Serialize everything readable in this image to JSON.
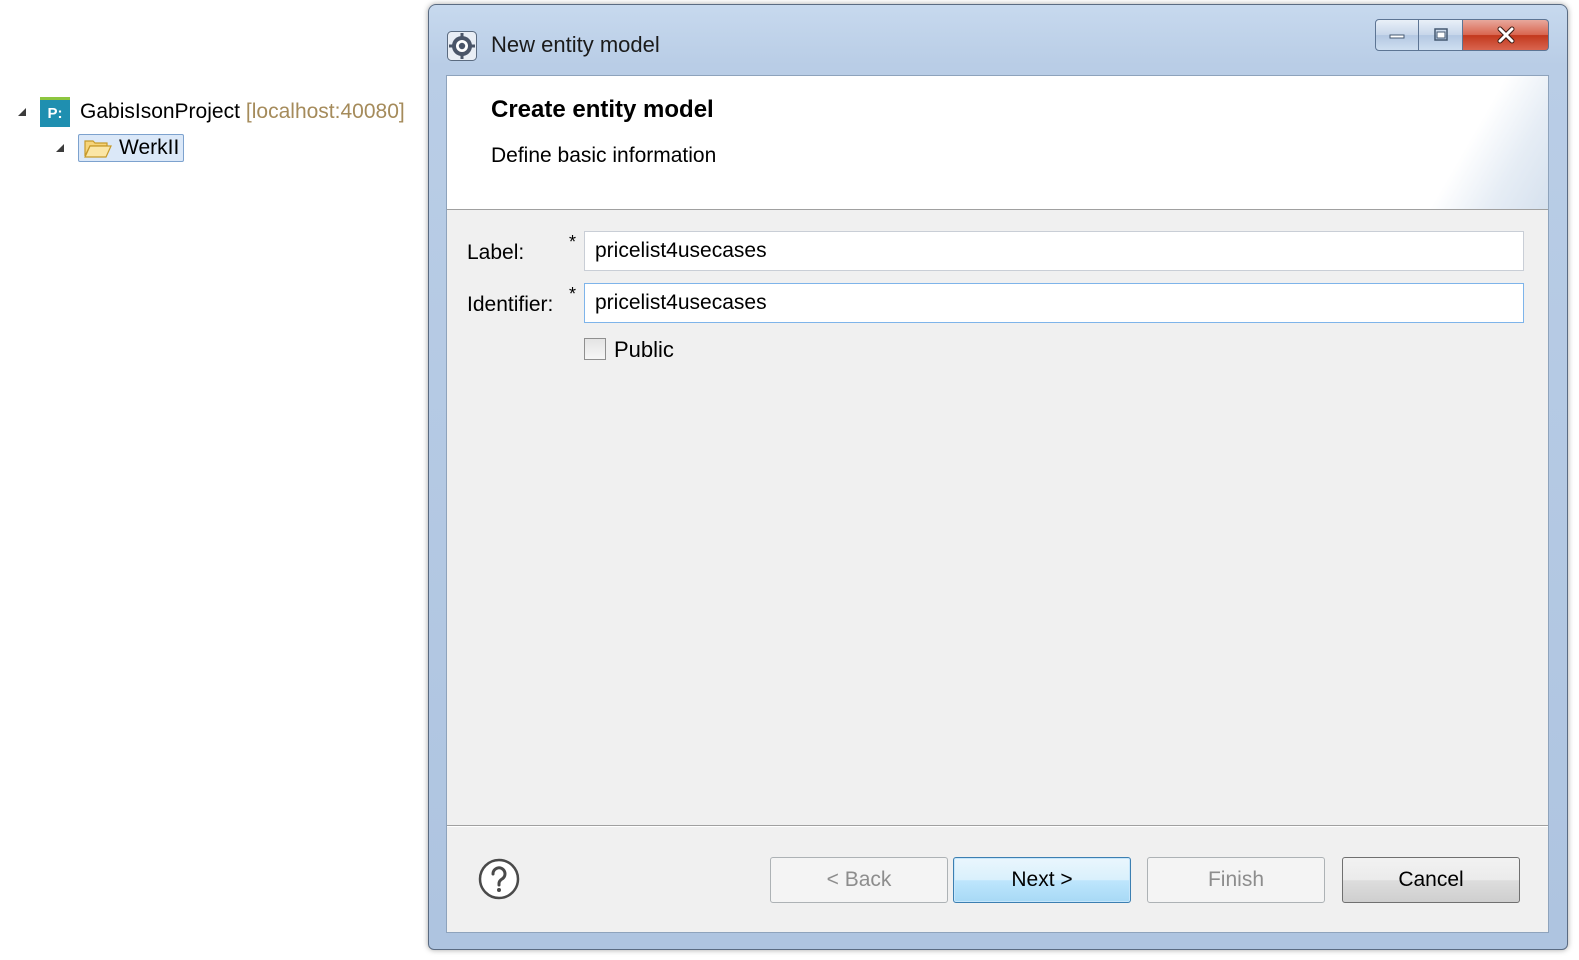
{
  "tree": {
    "project": {
      "icon": "project-icon",
      "icon_text": "P:",
      "name": "GabisIsonProject",
      "host": "[localhost:40080]"
    },
    "folder": {
      "icon": "folder-open-icon",
      "name": "WerkII"
    }
  },
  "dialog": {
    "title": "New entity model",
    "icon": "eclipse-gear-icon",
    "window_buttons": [
      "minimize-icon",
      "maximize-icon",
      "close-icon"
    ],
    "header": {
      "title": "Create entity model",
      "message": "Define basic information"
    },
    "form": {
      "label_field": {
        "label": "Label:",
        "required_marker": "*",
        "value": "pricelist4usecases"
      },
      "identifier_field": {
        "label": "Identifier:",
        "required_marker": "*",
        "value": "pricelist4usecases"
      },
      "public_checkbox": {
        "label": "Public",
        "checked": false
      }
    },
    "footer": {
      "help_icon": "help-icon",
      "back_label": "< Back",
      "next_label": "Next >",
      "finish_label": "Finish",
      "cancel_label": "Cancel"
    }
  },
  "colors": {
    "host_text": "#a58b5b",
    "dialog_frame": "#b9cde6",
    "close_button": "#c2381d",
    "default_button": "#bee6fd",
    "client_background": "#f0f0f0"
  }
}
